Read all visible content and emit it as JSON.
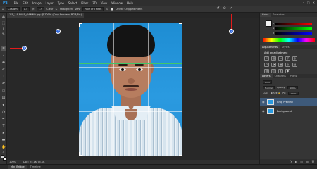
{
  "app": {
    "logo": "Ps"
  },
  "menu": [
    "File",
    "Edit",
    "Image",
    "Layer",
    "Type",
    "Select",
    "Filter",
    "3D",
    "View",
    "Window",
    "Help"
  ],
  "window_controls": [
    "–",
    "□",
    "✕"
  ],
  "options_bar": {
    "ratio_preset": "Custom",
    "width_value": "1.5",
    "height_value": "1.9",
    "clear_label": "Clear",
    "straighten_label": "Straighten",
    "view_label": "View",
    "view_value": "Rule of Thirds",
    "delete_cropped_label": "Delete Cropped Pixels",
    "reset_icon": "↺",
    "cancel_icon": "⊘",
    "commit_icon": "✓"
  },
  "document": {
    "tab_title": "1.5_1.9 PASS_GAMMA.jpg @ 100% (Crop Preview, RGB/8#)",
    "zoom": "100%",
    "doc_size": "Doc: 75.1K/75.1K"
  },
  "bottom_tabs": [
    "Mini Bridge",
    "Timeline"
  ],
  "annotations": [
    "1",
    "2",
    "3"
  ],
  "panels": {
    "color_tabs": [
      "Color",
      "Swatches"
    ],
    "color_channels": [
      "R",
      "G",
      "B"
    ],
    "adjustments_tabs": [
      "Adjustments",
      "Styles"
    ],
    "adjustments_title": "Add an adjustment",
    "adjustment_icons": [
      "☀",
      "▥",
      "≈",
      "▽",
      "◐",
      "⚖",
      "◑",
      "▦",
      "◎",
      "▤",
      "▧",
      "◫",
      "◧",
      "◆"
    ],
    "layers_tabs": [
      "Layers",
      "Channels",
      "Paths"
    ],
    "layers_kind": "Kind",
    "blend_mode": "Normal",
    "opacity_label": "Opacity:",
    "opacity_value": "100%",
    "lock_label": "Lock:",
    "fill_label": "Fill:",
    "fill_value": "100%",
    "layers": [
      {
        "name": "Crop Preview"
      },
      {
        "name": "Background"
      }
    ],
    "layer_footer_icons": [
      "fx",
      "◐",
      "▭",
      "▤",
      "🗑"
    ]
  },
  "colors": {
    "photo_background": "#1e8dd3",
    "annotation_dot": "#2a62d8",
    "annotation_arrow": "#e21b1b",
    "selected_layer": "#3e5a7a"
  }
}
